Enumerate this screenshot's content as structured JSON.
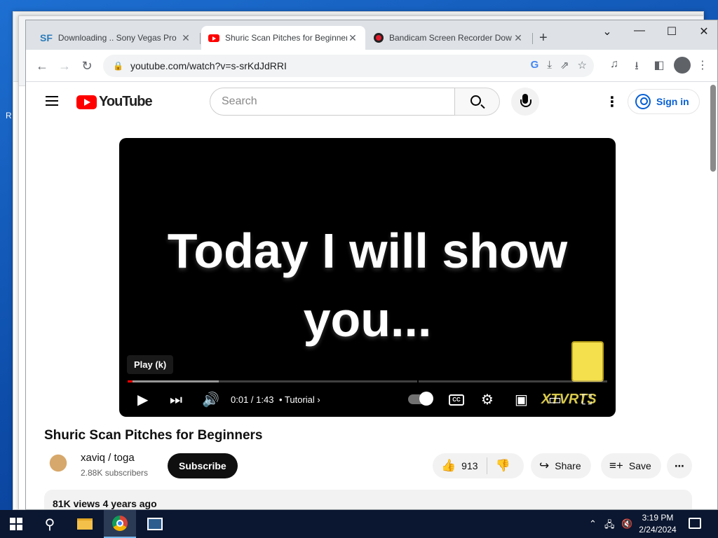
{
  "tabs": [
    {
      "label": "Downloading .. Sony Vegas Pro",
      "favicon": "sf-icon"
    },
    {
      "label": "Shuric Scan Pitches for Beginner",
      "favicon": "youtube-icon",
      "active": true
    },
    {
      "label": "Bandicam Screen Recorder Dow",
      "favicon": "bandicam-icon"
    }
  ],
  "address": {
    "url": "youtube.com/watch?v=s-srKdJdRRI"
  },
  "youtube": {
    "logo_text": "YouTube",
    "search_placeholder": "Search",
    "signin_label": "Sign in"
  },
  "player": {
    "caption_line1": "Today I will show",
    "caption_line2": "you...",
    "tooltip": "Play (k)",
    "time": "0:01 / 1:43",
    "chapter": "• Tutorial",
    "progress_played_fraction": 0.01,
    "progress_buffered_fraction": 0.19,
    "watermark_text": "XTVRTS"
  },
  "video": {
    "title": "Shuric Scan Pitches for Beginners",
    "channel_name": "xaviq / toga",
    "subscribers": "2.88K subscribers",
    "subscribe_label": "Subscribe",
    "likes": "913",
    "share_label": "Share",
    "save_label": "Save",
    "views_date": "81K views  4 years ago"
  },
  "desktop": {
    "edge_letter": "R"
  },
  "taskbar": {
    "time": "3:19 PM",
    "date": "2/24/2024"
  },
  "colors": {
    "youtube_red": "#ff0000",
    "link_blue": "#065fd4",
    "taskbar": "#0b1730"
  }
}
